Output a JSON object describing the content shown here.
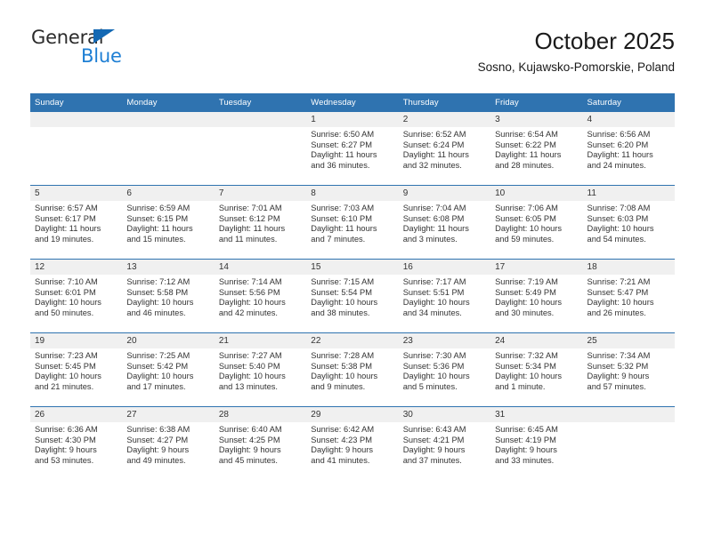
{
  "brand": {
    "word_general": "General",
    "word_blue": "Blue",
    "triangle_color": "#1368b3",
    "blue_color": "#1e7fd4"
  },
  "header": {
    "title": "October 2025",
    "subtitle": "Sosno, Kujawsko-Pomorskie, Poland",
    "header_bg": "#2f73b0",
    "daynum_bg": "#f0f0f0"
  },
  "weekday_headers": [
    "Sunday",
    "Monday",
    "Tuesday",
    "Wednesday",
    "Thursday",
    "Friday",
    "Saturday"
  ],
  "weeks": [
    [
      {
        "day": "",
        "sunrise": "",
        "sunset": "",
        "daylight_line1": "",
        "daylight_line2": ""
      },
      {
        "day": "",
        "sunrise": "",
        "sunset": "",
        "daylight_line1": "",
        "daylight_line2": ""
      },
      {
        "day": "",
        "sunrise": "",
        "sunset": "",
        "daylight_line1": "",
        "daylight_line2": ""
      },
      {
        "day": "1",
        "sunrise": "Sunrise: 6:50 AM",
        "sunset": "Sunset: 6:27 PM",
        "daylight_line1": "Daylight: 11 hours",
        "daylight_line2": "and 36 minutes."
      },
      {
        "day": "2",
        "sunrise": "Sunrise: 6:52 AM",
        "sunset": "Sunset: 6:24 PM",
        "daylight_line1": "Daylight: 11 hours",
        "daylight_line2": "and 32 minutes."
      },
      {
        "day": "3",
        "sunrise": "Sunrise: 6:54 AM",
        "sunset": "Sunset: 6:22 PM",
        "daylight_line1": "Daylight: 11 hours",
        "daylight_line2": "and 28 minutes."
      },
      {
        "day": "4",
        "sunrise": "Sunrise: 6:56 AM",
        "sunset": "Sunset: 6:20 PM",
        "daylight_line1": "Daylight: 11 hours",
        "daylight_line2": "and 24 minutes."
      }
    ],
    [
      {
        "day": "5",
        "sunrise": "Sunrise: 6:57 AM",
        "sunset": "Sunset: 6:17 PM",
        "daylight_line1": "Daylight: 11 hours",
        "daylight_line2": "and 19 minutes."
      },
      {
        "day": "6",
        "sunrise": "Sunrise: 6:59 AM",
        "sunset": "Sunset: 6:15 PM",
        "daylight_line1": "Daylight: 11 hours",
        "daylight_line2": "and 15 minutes."
      },
      {
        "day": "7",
        "sunrise": "Sunrise: 7:01 AM",
        "sunset": "Sunset: 6:12 PM",
        "daylight_line1": "Daylight: 11 hours",
        "daylight_line2": "and 11 minutes."
      },
      {
        "day": "8",
        "sunrise": "Sunrise: 7:03 AM",
        "sunset": "Sunset: 6:10 PM",
        "daylight_line1": "Daylight: 11 hours",
        "daylight_line2": "and 7 minutes."
      },
      {
        "day": "9",
        "sunrise": "Sunrise: 7:04 AM",
        "sunset": "Sunset: 6:08 PM",
        "daylight_line1": "Daylight: 11 hours",
        "daylight_line2": "and 3 minutes."
      },
      {
        "day": "10",
        "sunrise": "Sunrise: 7:06 AM",
        "sunset": "Sunset: 6:05 PM",
        "daylight_line1": "Daylight: 10 hours",
        "daylight_line2": "and 59 minutes."
      },
      {
        "day": "11",
        "sunrise": "Sunrise: 7:08 AM",
        "sunset": "Sunset: 6:03 PM",
        "daylight_line1": "Daylight: 10 hours",
        "daylight_line2": "and 54 minutes."
      }
    ],
    [
      {
        "day": "12",
        "sunrise": "Sunrise: 7:10 AM",
        "sunset": "Sunset: 6:01 PM",
        "daylight_line1": "Daylight: 10 hours",
        "daylight_line2": "and 50 minutes."
      },
      {
        "day": "13",
        "sunrise": "Sunrise: 7:12 AM",
        "sunset": "Sunset: 5:58 PM",
        "daylight_line1": "Daylight: 10 hours",
        "daylight_line2": "and 46 minutes."
      },
      {
        "day": "14",
        "sunrise": "Sunrise: 7:14 AM",
        "sunset": "Sunset: 5:56 PM",
        "daylight_line1": "Daylight: 10 hours",
        "daylight_line2": "and 42 minutes."
      },
      {
        "day": "15",
        "sunrise": "Sunrise: 7:15 AM",
        "sunset": "Sunset: 5:54 PM",
        "daylight_line1": "Daylight: 10 hours",
        "daylight_line2": "and 38 minutes."
      },
      {
        "day": "16",
        "sunrise": "Sunrise: 7:17 AM",
        "sunset": "Sunset: 5:51 PM",
        "daylight_line1": "Daylight: 10 hours",
        "daylight_line2": "and 34 minutes."
      },
      {
        "day": "17",
        "sunrise": "Sunrise: 7:19 AM",
        "sunset": "Sunset: 5:49 PM",
        "daylight_line1": "Daylight: 10 hours",
        "daylight_line2": "and 30 minutes."
      },
      {
        "day": "18",
        "sunrise": "Sunrise: 7:21 AM",
        "sunset": "Sunset: 5:47 PM",
        "daylight_line1": "Daylight: 10 hours",
        "daylight_line2": "and 26 minutes."
      }
    ],
    [
      {
        "day": "19",
        "sunrise": "Sunrise: 7:23 AM",
        "sunset": "Sunset: 5:45 PM",
        "daylight_line1": "Daylight: 10 hours",
        "daylight_line2": "and 21 minutes."
      },
      {
        "day": "20",
        "sunrise": "Sunrise: 7:25 AM",
        "sunset": "Sunset: 5:42 PM",
        "daylight_line1": "Daylight: 10 hours",
        "daylight_line2": "and 17 minutes."
      },
      {
        "day": "21",
        "sunrise": "Sunrise: 7:27 AM",
        "sunset": "Sunset: 5:40 PM",
        "daylight_line1": "Daylight: 10 hours",
        "daylight_line2": "and 13 minutes."
      },
      {
        "day": "22",
        "sunrise": "Sunrise: 7:28 AM",
        "sunset": "Sunset: 5:38 PM",
        "daylight_line1": "Daylight: 10 hours",
        "daylight_line2": "and 9 minutes."
      },
      {
        "day": "23",
        "sunrise": "Sunrise: 7:30 AM",
        "sunset": "Sunset: 5:36 PM",
        "daylight_line1": "Daylight: 10 hours",
        "daylight_line2": "and 5 minutes."
      },
      {
        "day": "24",
        "sunrise": "Sunrise: 7:32 AM",
        "sunset": "Sunset: 5:34 PM",
        "daylight_line1": "Daylight: 10 hours",
        "daylight_line2": "and 1 minute."
      },
      {
        "day": "25",
        "sunrise": "Sunrise: 7:34 AM",
        "sunset": "Sunset: 5:32 PM",
        "daylight_line1": "Daylight: 9 hours",
        "daylight_line2": "and 57 minutes."
      }
    ],
    [
      {
        "day": "26",
        "sunrise": "Sunrise: 6:36 AM",
        "sunset": "Sunset: 4:30 PM",
        "daylight_line1": "Daylight: 9 hours",
        "daylight_line2": "and 53 minutes."
      },
      {
        "day": "27",
        "sunrise": "Sunrise: 6:38 AM",
        "sunset": "Sunset: 4:27 PM",
        "daylight_line1": "Daylight: 9 hours",
        "daylight_line2": "and 49 minutes."
      },
      {
        "day": "28",
        "sunrise": "Sunrise: 6:40 AM",
        "sunset": "Sunset: 4:25 PM",
        "daylight_line1": "Daylight: 9 hours",
        "daylight_line2": "and 45 minutes."
      },
      {
        "day": "29",
        "sunrise": "Sunrise: 6:42 AM",
        "sunset": "Sunset: 4:23 PM",
        "daylight_line1": "Daylight: 9 hours",
        "daylight_line2": "and 41 minutes."
      },
      {
        "day": "30",
        "sunrise": "Sunrise: 6:43 AM",
        "sunset": "Sunset: 4:21 PM",
        "daylight_line1": "Daylight: 9 hours",
        "daylight_line2": "and 37 minutes."
      },
      {
        "day": "31",
        "sunrise": "Sunrise: 6:45 AM",
        "sunset": "Sunset: 4:19 PM",
        "daylight_line1": "Daylight: 9 hours",
        "daylight_line2": "and 33 minutes."
      },
      {
        "day": "",
        "sunrise": "",
        "sunset": "",
        "daylight_line1": "",
        "daylight_line2": ""
      }
    ]
  ]
}
